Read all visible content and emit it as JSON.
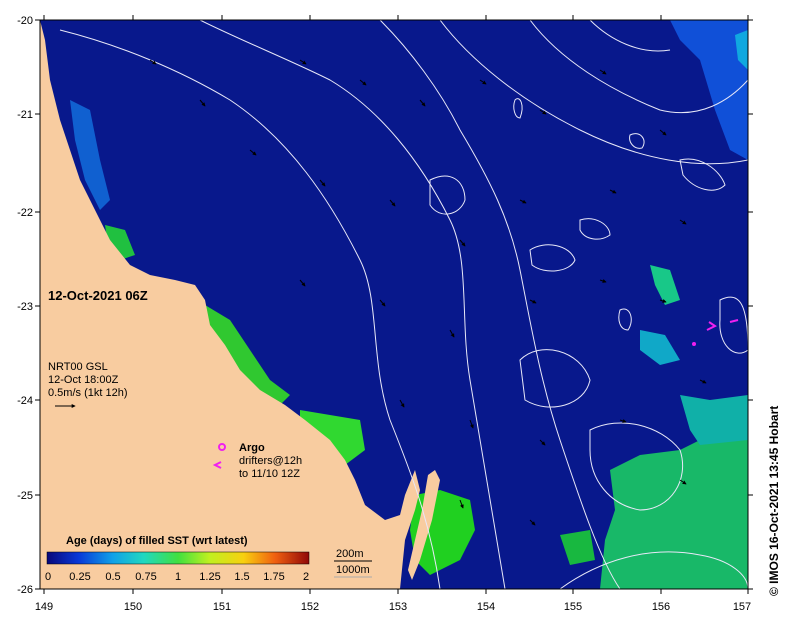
{
  "map": {
    "date": "12-Oct-2021 06Z",
    "x_axis": {
      "min": 149,
      "max": 157,
      "ticks": [
        "149",
        "150",
        "151",
        "152",
        "153",
        "154",
        "155",
        "156",
        "157"
      ]
    },
    "y_axis": {
      "min": -26,
      "max": -20,
      "ticks": [
        "-20",
        "-21",
        "-22",
        "-23",
        "-24",
        "-25",
        "-26"
      ]
    },
    "current_info": {
      "line1": "NRT00 GSL",
      "line2": "12-Oct 18:00Z",
      "line3": "0.5m/s (1kt 12h)"
    },
    "argo": {
      "title": "Argo",
      "line1": "drifters@12h",
      "line2": "to 11/10 12Z"
    },
    "colorbar": {
      "title": "Age (days) of filled SST (wrt latest)",
      "labels": [
        "0",
        "0.25",
        "0.5",
        "0.75",
        "1",
        "1.25",
        "1.5",
        "1.75",
        "2"
      ]
    },
    "depth_legend": {
      "line1": "200m",
      "line2": "1000m"
    },
    "credit": "© IMOS 16-Oct-2021 13:45 Hobart",
    "colors": {
      "land": "#f8cca0",
      "ocean": "#08188c",
      "green": "#18c838",
      "cyan": "#10a8e0",
      "yellow": "#f8f020",
      "argo": "#f020f0"
    }
  }
}
